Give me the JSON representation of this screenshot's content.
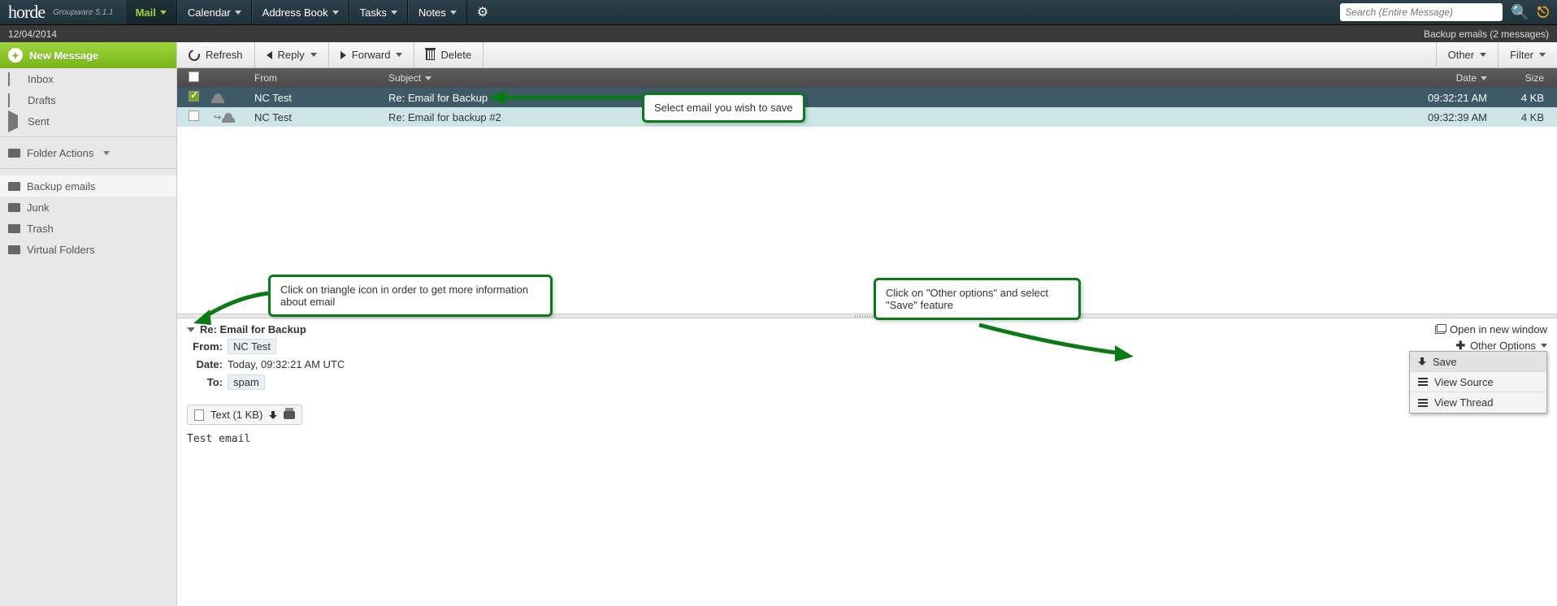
{
  "brand": {
    "name": "horde",
    "version": "Groupware 5.1.1"
  },
  "topnav": {
    "mail": "Mail",
    "calendar": "Calendar",
    "addressbook": "Address Book",
    "tasks": "Tasks",
    "notes": "Notes"
  },
  "search": {
    "placeholder": "Search (Entire Message)"
  },
  "datebar": {
    "date": "12/04/2014",
    "status": "Backup emails (2 messages)"
  },
  "sidebar": {
    "newmsg": "New Message",
    "inbox": "Inbox",
    "drafts": "Drafts",
    "sent": "Sent",
    "folder_actions": "Folder Actions",
    "folders": {
      "backup": "Backup emails",
      "junk": "Junk",
      "trash": "Trash",
      "virtual": "Virtual Folders"
    }
  },
  "toolbar": {
    "refresh": "Refresh",
    "reply": "Reply",
    "forward": "Forward",
    "delete": "Delete",
    "other": "Other",
    "filter": "Filter"
  },
  "columns": {
    "from": "From",
    "subject": "Subject",
    "date": "Date",
    "size": "Size"
  },
  "messages": [
    {
      "from": "NC Test",
      "subject": "Re: Email for Backup",
      "date": "09:32:21 AM",
      "size": "4 KB",
      "selected": true,
      "replied": false
    },
    {
      "from": "NC Test",
      "subject": "Re: Email for backup #2",
      "date": "09:32:39 AM",
      "size": "4 KB",
      "selected": false,
      "replied": true
    }
  ],
  "preview": {
    "subject": "Re: Email for Backup",
    "from_label": "From:",
    "from": "NC Test",
    "date_label": "Date:",
    "date": "Today, 09:32:21 AM UTC",
    "to_label": "To:",
    "to": "spam",
    "open_window": "Open in new window",
    "other_options": "Other Options",
    "attachment_label": "Text (1 KB)",
    "body": "Test email"
  },
  "popup": {
    "save": "Save",
    "view_source": "View Source",
    "view_thread": "View Thread"
  },
  "callouts": {
    "c1": "Select email you wish to save",
    "c2": "Click on triangle icon in order to get more information about email",
    "c3": "Click on \"Other options\" and select \"Save\" feature"
  }
}
